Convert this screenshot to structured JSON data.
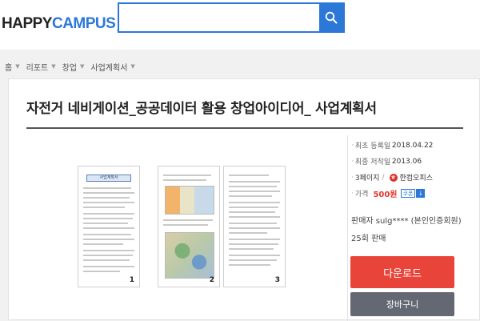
{
  "header": {
    "logo": {
      "part1": "HAPPY",
      "part2": "CAMPUS",
      "mark": "!"
    },
    "search": {
      "value": "",
      "placeholder": ""
    },
    "search_icon": "search-icon"
  },
  "breadcrumb": [
    "홈",
    "리포트",
    "창업",
    "사업계획서"
  ],
  "document": {
    "title": "자전거 네비게이션_공공데이터 활용 창업아이디어_ 사업계획서",
    "preview_pages": [
      "1",
      "2",
      "3"
    ],
    "preview_header_text": "사업계획서"
  },
  "info": {
    "registered_label": "최초 등록일",
    "registered_value": "2018.04.22",
    "written_label": "최종 저작일",
    "written_value": "2013.06",
    "pages": "3페이지",
    "separator": "/",
    "format": "한컴오피스",
    "price_label": "가격",
    "price_value": "500원",
    "coupon_label": "쿠폰"
  },
  "seller": "판매자 sulg**** (본인인증회원)",
  "sales": "25회 판매",
  "buttons": {
    "download": "다운로드",
    "cart": "장바구니"
  },
  "colors": {
    "brand": "#2b78d8",
    "download": "#e9443a",
    "cart": "#646873",
    "price": "#e3372d"
  }
}
